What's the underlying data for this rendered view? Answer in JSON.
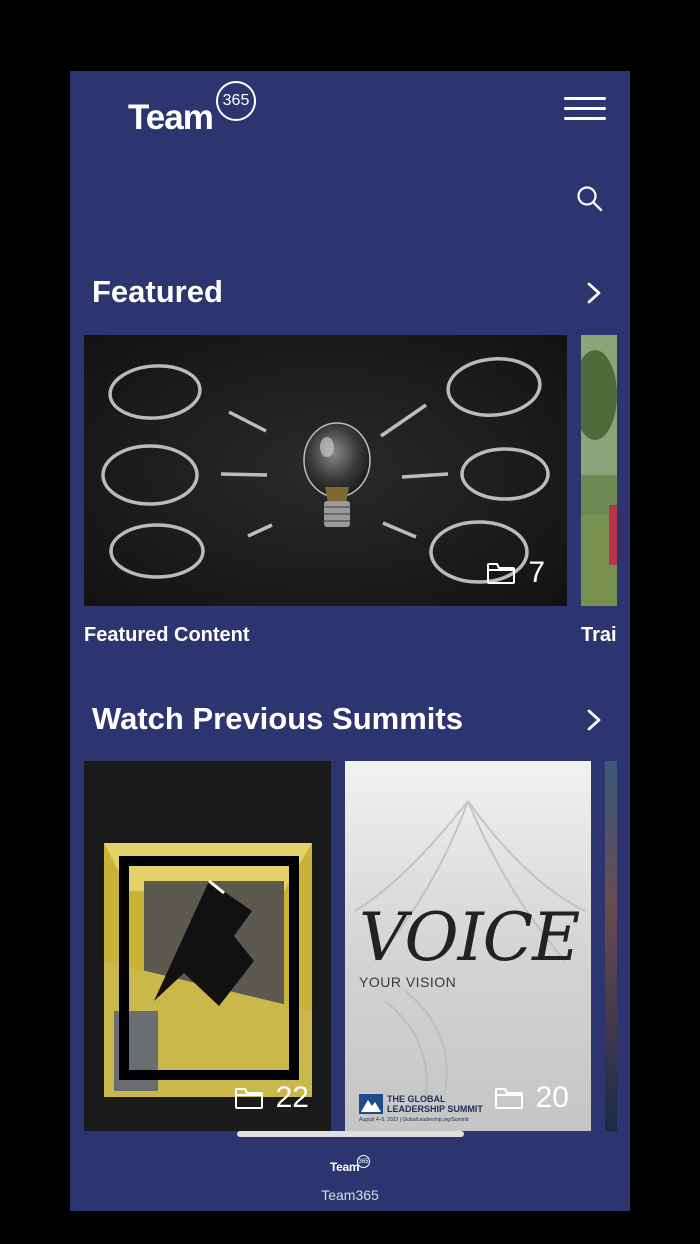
{
  "brand": {
    "logo_text": "Team",
    "logo_badge": "365"
  },
  "header": {
    "menu_icon": "hamburger-menu-icon",
    "search_icon": "search-icon"
  },
  "sections": [
    {
      "title": "Featured",
      "cards": [
        {
          "label": "Featured Content",
          "count": "7",
          "image": "chalkboard-lightbulb"
        },
        {
          "label": "Trai",
          "image": "person-in-park"
        }
      ]
    },
    {
      "title": "Watch Previous Summits",
      "cards": [
        {
          "count": "22",
          "image": "abstract-subway-poster"
        },
        {
          "count": "20",
          "image": "voice-your-vision-poster",
          "poster": {
            "headline": "VOICE",
            "subhead": "YOUR VISION",
            "org_line1": "THE GLOBAL",
            "org_line2": "LEADERSHIP SUMMIT",
            "fine_print": "August 4–5, 2022 | GlobalLeadership.org/Summit"
          }
        },
        {
          "image": "night-sky"
        }
      ]
    }
  ],
  "footer": {
    "label": "Team365",
    "logo_text": "Team",
    "logo_badge": "365"
  },
  "colors": {
    "background": "#2d3571",
    "text": "#ffffff",
    "scroll_indicator": "#e0e0e0"
  }
}
